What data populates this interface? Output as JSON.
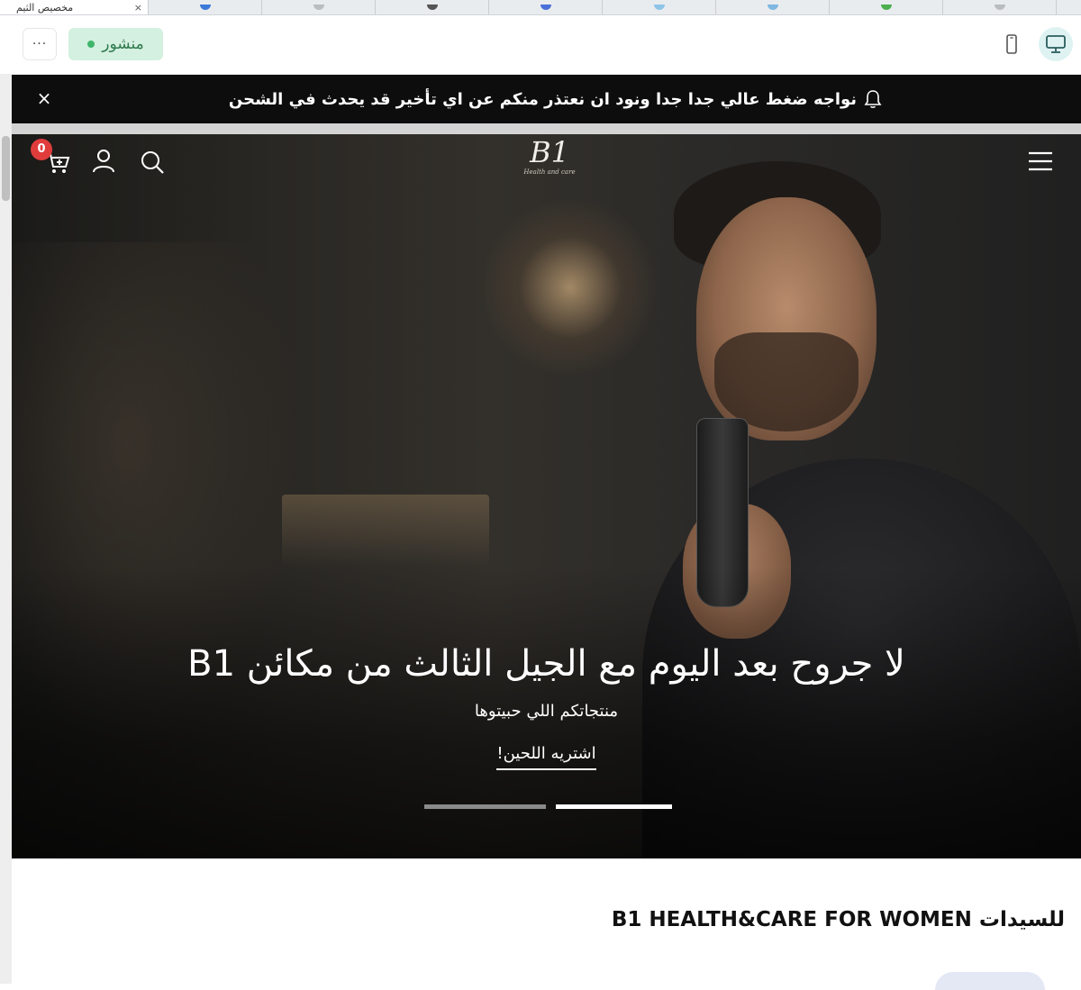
{
  "browser": {
    "active_tab_title": "مخصيص الثيم",
    "tab_close": "×"
  },
  "toolbar": {
    "more_label": "···",
    "status_label": "منشور",
    "status_color": "#3fb56b",
    "accent_color": "#dff2f2"
  },
  "announcement": {
    "text": "نواجه ضغط عالي جدا جدا ونود ان نعتذر منكم عن اي تأخير قد يحدث في الشحن",
    "close": "×",
    "icon": "bell-icon"
  },
  "header": {
    "logo_text": "B1",
    "logo_tagline": "Health and care",
    "cart_count": "0",
    "icons": [
      "cart-icon",
      "user-icon",
      "search-icon",
      "menu-icon"
    ]
  },
  "hero": {
    "title": "لا جروح بعد اليوم مع الجيل الثالث من مكائن B1",
    "subtitle": "منتجاتكم اللي حبيتوها",
    "cta": "اشتريه اللحين!",
    "active_slide": 2,
    "slide_count": 2
  },
  "section": {
    "title": "للسيدات B1 HEALTH&CARE FOR WOMEN"
  }
}
